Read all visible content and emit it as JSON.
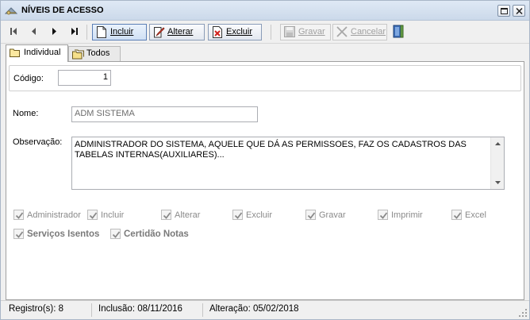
{
  "window": {
    "title": "NÍVEIS DE ACESSO",
    "icon": "key-icon"
  },
  "toolbar": {
    "nav": [
      "first-record-icon",
      "previous-record-icon",
      "next-record-icon",
      "last-record-icon"
    ],
    "incluir": "Incluir",
    "alterar": "Alterar",
    "excluir": "Excluir",
    "gravar": "Gravar",
    "cancelar": "Cancelar"
  },
  "tabs": {
    "individual": "Individual",
    "todos": "Todos"
  },
  "form": {
    "codigo_label": "Código:",
    "codigo_value": "1",
    "nome_label": "Nome:",
    "nome_value": "ADM SISTEMA",
    "obs_label": "Observação:",
    "obs_value": "ADMINISTRADOR DO SISTEMA, AQUELE QUE DÁ AS PERMISSOES, FAZ OS CADASTROS DAS TABELAS INTERNAS(AUXILIARES)..."
  },
  "permissions": [
    {
      "label": "Administrador",
      "checked": true
    },
    {
      "label": "Incluir",
      "checked": true
    },
    {
      "label": "Alterar",
      "checked": true
    },
    {
      "label": "Excluir",
      "checked": true
    },
    {
      "label": "Gravar",
      "checked": true
    },
    {
      "label": "Imprimir",
      "checked": true
    },
    {
      "label": "Excel",
      "checked": true
    }
  ],
  "extras": [
    {
      "label": "Serviços Isentos",
      "checked": true
    },
    {
      "label": "Certidão Notas",
      "checked": true
    }
  ],
  "status": {
    "registros": "Registro(s): 8",
    "inclusao": "Inclusão: 08/11/2016",
    "alteracao": "Alteração: 05/02/2018"
  },
  "colors": {
    "title_bar": "#cbd9ea",
    "active_button": "#cfe0f5",
    "disabled_text": "#a0a0a0"
  }
}
